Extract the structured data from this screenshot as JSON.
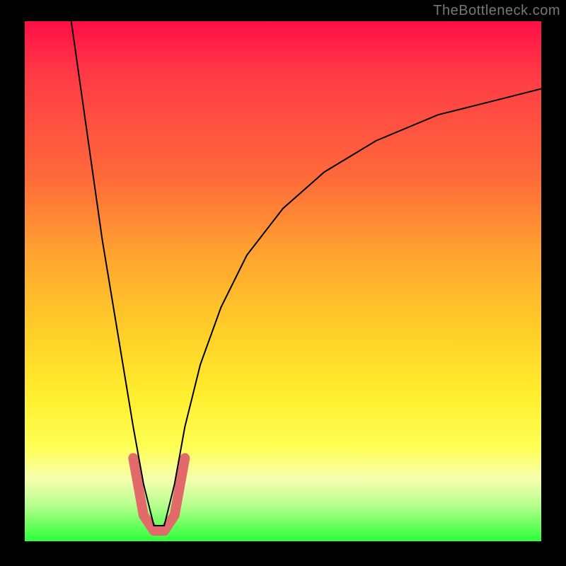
{
  "watermark": "TheBottleneck.com",
  "chart_data": {
    "type": "line",
    "title": "",
    "xlabel": "",
    "ylabel": "",
    "xlim": [
      0,
      100
    ],
    "ylim": [
      0,
      100
    ],
    "grid": false,
    "legend": false,
    "annotations": [],
    "series": [
      {
        "name": "bottleneck-curve",
        "description": "Asymmetric V-shaped bottleneck curve; minimum (0% bottleneck) near x≈25. Left branch very steep, right branch rises with decreasing slope toward top-right.",
        "color": "#000000",
        "x": [
          9,
          11,
          13,
          15,
          17,
          19,
          21,
          23,
          25,
          27,
          29,
          31,
          34,
          38,
          43,
          50,
          58,
          68,
          80,
          92,
          100
        ],
        "y": [
          100,
          86,
          72,
          58,
          46,
          34,
          22,
          11,
          3,
          3,
          11,
          22,
          34,
          45,
          55,
          64,
          71,
          77,
          82,
          85,
          87
        ]
      },
      {
        "name": "trough-highlight",
        "description": "Thick rounded highlight at the bottom of the V marking the optimal zone.",
        "color": "#e26a6b",
        "x": [
          21,
          23,
          25,
          27,
          29,
          31
        ],
        "y": [
          16,
          5,
          2,
          2,
          5,
          16
        ]
      }
    ],
    "background_gradient": {
      "stops": [
        {
          "pos": 0.0,
          "color": "#ff0f46"
        },
        {
          "pos": 0.3,
          "color": "#ff6a3a"
        },
        {
          "pos": 0.6,
          "color": "#ffd028"
        },
        {
          "pos": 0.82,
          "color": "#feff55"
        },
        {
          "pos": 1.0,
          "color": "#2cff3a"
        }
      ]
    }
  }
}
